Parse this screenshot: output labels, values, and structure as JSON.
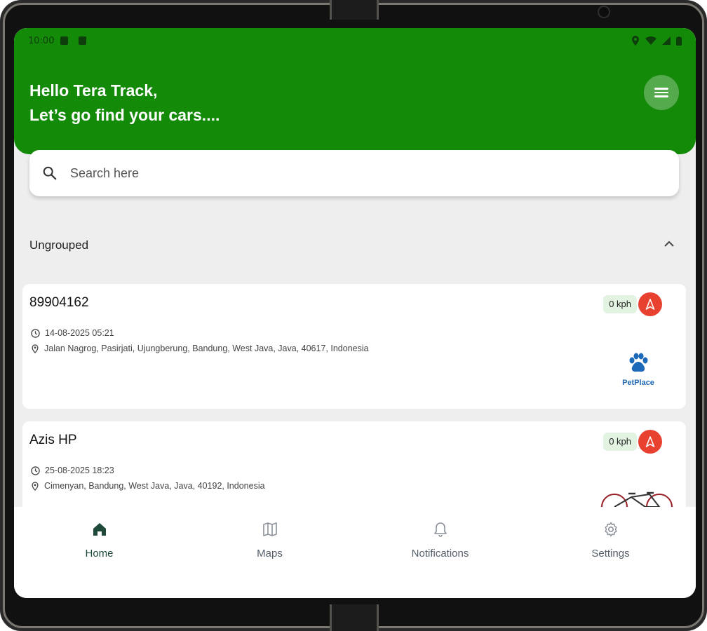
{
  "status_bar": {
    "time": "10:00"
  },
  "header": {
    "greeting_line1": "Hello Tera Track,",
    "greeting_line2": "Let’s go find your cars...."
  },
  "search": {
    "placeholder": "Search here"
  },
  "group": {
    "title": "Ungrouped"
  },
  "vehicles": [
    {
      "name": "89904162",
      "timestamp": "14-08-2025 05:21",
      "address": "Jalan Nagrog, Pasirjati, Ujungberung, Bandung, West Java, Java, 40617, Indonesia",
      "speed": "0 kph",
      "brand": "PetPlace"
    },
    {
      "name": "Azis HP",
      "timestamp": "25-08-2025 18:23",
      "address": "Cimenyan, Bandung, West Java, Java, 40192, Indonesia",
      "speed": "0 kph"
    }
  ],
  "nav": {
    "items": [
      {
        "label": "Home",
        "icon": "home-icon"
      },
      {
        "label": "Maps",
        "icon": "map-icon"
      },
      {
        "label": "Notifications",
        "icon": "bell-icon"
      },
      {
        "label": "Settings",
        "icon": "gear-icon"
      }
    ],
    "active": "Home"
  },
  "colors": {
    "header": "#148a09",
    "status_red": "#e8412f",
    "speed_badge": "#e3f3e1",
    "brand_blue": "#1b69b8"
  }
}
